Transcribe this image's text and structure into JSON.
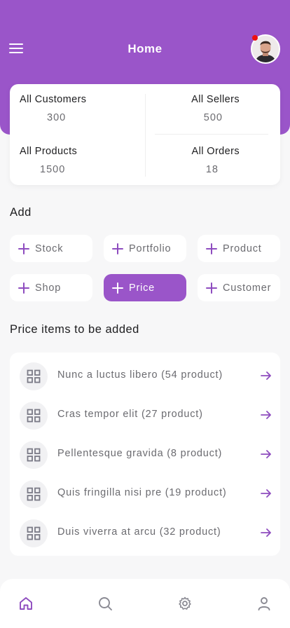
{
  "header": {
    "title": "Home"
  },
  "stats": [
    {
      "label": "All Customers",
      "value": "300"
    },
    {
      "label": "All Sellers",
      "value": "500"
    },
    {
      "label": "All Products",
      "value": "1500"
    },
    {
      "label": "All Orders",
      "value": "18"
    }
  ],
  "add_section": {
    "title": "Add",
    "chips": [
      "Stock",
      "Portfolio",
      "Product",
      "Shop",
      "Price",
      "Customer"
    ],
    "active_chip": "Price"
  },
  "list_section": {
    "title": "Price items to be added",
    "items": [
      "Nunc a luctus libero (54 product)",
      "Cras tempor elit (27 product)",
      "Pellentesque gravida (8 product)",
      "Quis fringilla nisi pre (19 product)",
      "Duis viverra at arcu (32 product)"
    ]
  },
  "tabbar": {
    "tabs": [
      "home-icon",
      "search-icon",
      "settings-icon",
      "profile-icon"
    ],
    "active": "home-icon"
  },
  "colors": {
    "accent": "#9a55c9",
    "notification": "#e11111"
  }
}
